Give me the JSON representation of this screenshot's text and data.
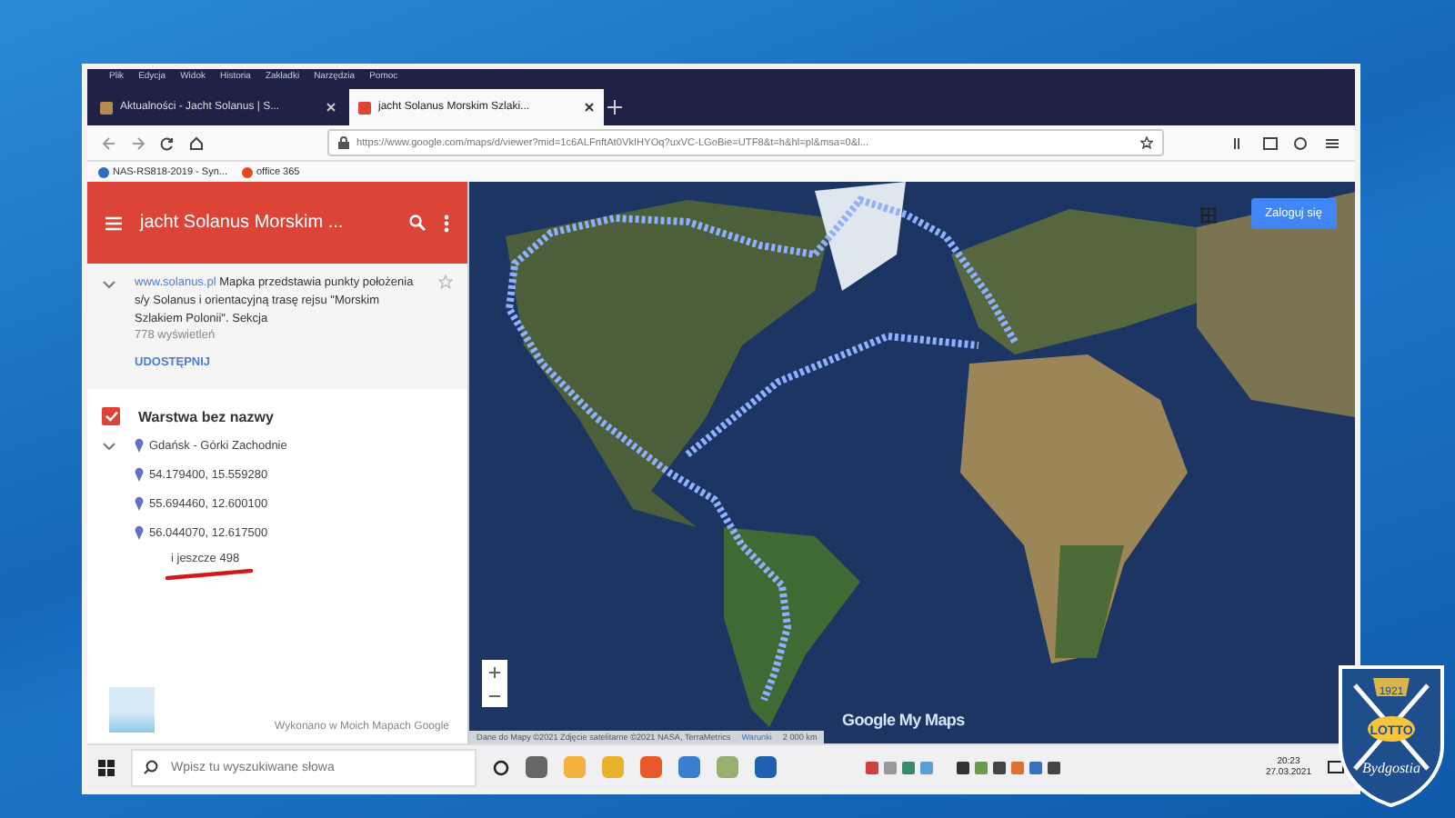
{
  "browser": {
    "menu": [
      "Plik",
      "Edycja",
      "Widok",
      "Historia",
      "Zakładki",
      "Narzędzia",
      "Pomoc"
    ],
    "tabs": [
      {
        "title": "Aktualności - Jacht Solanus | S...",
        "selected": false
      },
      {
        "title": "jacht Solanus Morskim Szlaki...",
        "selected": true
      }
    ],
    "url": "https://www.google.com/maps/d/viewer?mid=1c6ALFnftAt0VkIHYOq?uxVC-LGoBie=UTF8&t=h&hl=pl&msa=0&l...",
    "bookmarks": [
      "NAS-RS818-2019 - Syn...",
      "office 365"
    ]
  },
  "panel": {
    "title": "jacht Solanus Morskim ...",
    "link": "www.solanus.pl",
    "description": "Mapka przedstawia punkty położenia s/y Solanus i orientacyjną trasę rejsu \"Morskim Szlakiem Polonii\". Sekcja",
    "views": "778 wyświetleń",
    "share": "UDOSTĘPNIJ",
    "layer": {
      "name": "Warstwa bez nazwy",
      "checked": true,
      "expanded": true,
      "places": [
        "Gdańsk - Górki Zachodnie",
        "54.179400, 15.559280",
        "55.694460, 12.600100",
        "56.044070, 12.617500"
      ],
      "more": "i jeszcze 498"
    },
    "footer": "Wykonano w Moich Mapach Google"
  },
  "map": {
    "sign_in": "Zaloguj się",
    "logo": "Google My Maps",
    "attribution": "Dane do Mapy ©2021 Zdjęcie satelitarne ©2021 NASA, TerraMetrics",
    "terms": "Warunki",
    "scale": "2 000 km"
  },
  "taskbar": {
    "search_placeholder": "Wpisz tu wyszukiwane słowa",
    "time": "20:23",
    "date": "27.03.2021"
  },
  "badge": {
    "year": "1921",
    "brand": "LOTTO",
    "name": "Bydgostia"
  }
}
